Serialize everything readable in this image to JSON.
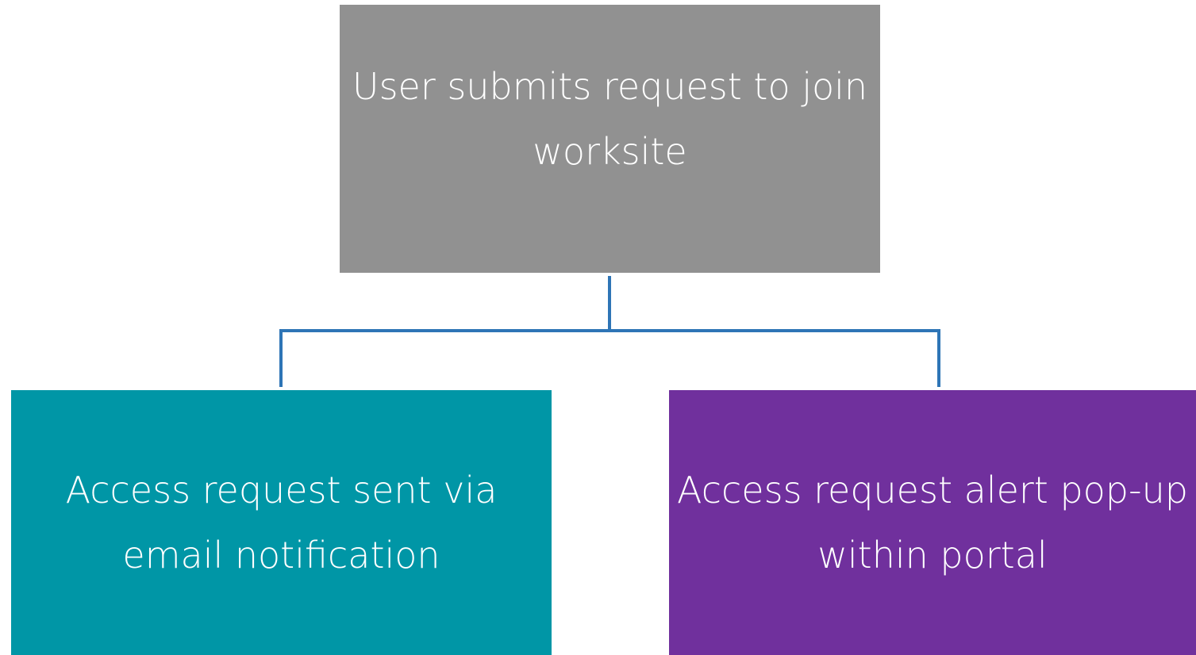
{
  "diagram": {
    "connector_color": "#2E75B6",
    "nodes": [
      {
        "id": "top",
        "label": "User submits request to join worksite",
        "color": "#919191"
      },
      {
        "id": "left",
        "label": "Access request sent via email notification",
        "color": "#0096A6"
      },
      {
        "id": "right",
        "label": "Access request alert pop-up within portal",
        "color": "#70309D"
      }
    ]
  }
}
